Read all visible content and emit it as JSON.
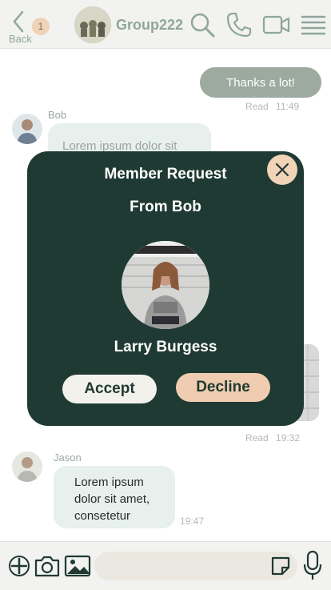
{
  "header": {
    "back_label": "Back",
    "back_badge": "1",
    "group_name": "Group222",
    "icons": [
      "search-icon",
      "phone-icon",
      "video-icon",
      "menu-icon"
    ]
  },
  "messages": {
    "me1": {
      "text": "Thanks a lot!",
      "status": "Read",
      "time": "11:49"
    },
    "bob": {
      "sender": "Bob",
      "text": "Lorem ipsum dolor sit"
    },
    "hidden_meta": {
      "status": "Read",
      "time": "19:32"
    },
    "jason": {
      "sender": "Jason",
      "text": "Lorem ipsum dolor sit amet, consetetur",
      "time": "19:47"
    }
  },
  "modal": {
    "title": "Member Request",
    "from": "From Bob",
    "name": "Larry Burgess",
    "accept": "Accept",
    "decline": "Decline"
  },
  "composer": {
    "icons": [
      "plus-icon",
      "camera-icon",
      "image-icon",
      "sticker-icon",
      "mic-icon"
    ],
    "placeholder": ""
  },
  "colors": {
    "accent": "#1f3a33",
    "sage": "#8fa69d",
    "peach": "#f0cdb0",
    "bubble_me": "#9caa9f",
    "bubble_them": "#e7f0ec"
  }
}
